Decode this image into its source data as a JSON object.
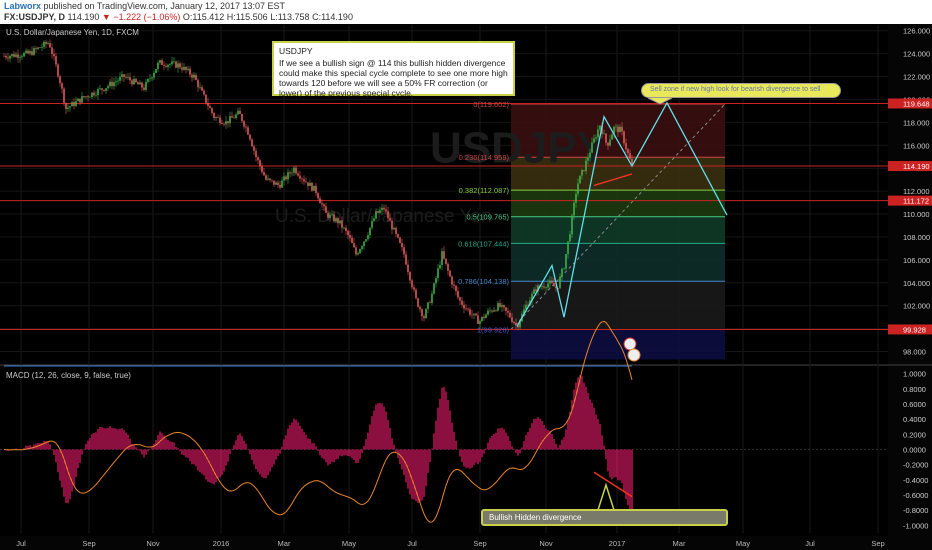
{
  "header": {
    "author": "Labworx",
    "published": " published on TradingView.com, January 12, 2017 13:07 EST",
    "symbol": "FX:USDJPY, D",
    "last": "114.190",
    "change": "▼ −1.222 (−1.06%)",
    "o": "O:115.412",
    "h": "H:115.506",
    "l": "L:113.758",
    "c": "C:114.190"
  },
  "chart_data": [
    {
      "type": "candlestick",
      "title": "U.S. Dollar/Japanese Yen, 1D, FXCM",
      "watermark_symbol": "USDJPY",
      "watermark_name": "U.S. Dollar/Japanese Yen",
      "ylim": [
        97,
        126.5
      ],
      "y_ticks": [
        "126.000",
        "124.000",
        "122.000",
        "120.000",
        "118.000",
        "116.000",
        "114.000",
        "112.000",
        "110.000",
        "108.000",
        "106.000",
        "104.000",
        "102.000",
        "100.000",
        "98.000"
      ],
      "x_ticks": [
        "Jul",
        "Sep",
        "Nov",
        "2016",
        "Mar",
        "May",
        "Jul",
        "Sep",
        "Nov",
        "2017",
        "Mar",
        "May",
        "Jul",
        "Sep"
      ],
      "path_keypoints": [
        {
          "t": 0,
          "v": 123.8
        },
        {
          "t": 25,
          "v": 124.0
        },
        {
          "t": 45,
          "v": 125.0
        },
        {
          "t": 55,
          "v": 122.0
        },
        {
          "t": 62,
          "v": 119.2
        },
        {
          "t": 80,
          "v": 120.2
        },
        {
          "t": 100,
          "v": 121.0
        },
        {
          "t": 120,
          "v": 122.0
        },
        {
          "t": 140,
          "v": 121.0
        },
        {
          "t": 155,
          "v": 123.2
        },
        {
          "t": 175,
          "v": 123.0
        },
        {
          "t": 190,
          "v": 122.0
        },
        {
          "t": 200,
          "v": 120.2
        },
        {
          "t": 210,
          "v": 118.5
        },
        {
          "t": 222,
          "v": 118.0
        },
        {
          "t": 235,
          "v": 118.8
        },
        {
          "t": 245,
          "v": 117.0
        },
        {
          "t": 252,
          "v": 115.0
        },
        {
          "t": 262,
          "v": 113.0
        },
        {
          "t": 275,
          "v": 112.5
        },
        {
          "t": 290,
          "v": 114.0
        },
        {
          "t": 300,
          "v": 113.0
        },
        {
          "t": 312,
          "v": 112.0
        },
        {
          "t": 322,
          "v": 110.0
        },
        {
          "t": 335,
          "v": 109.3
        },
        {
          "t": 345,
          "v": 108.0
        },
        {
          "t": 352,
          "v": 106.5
        },
        {
          "t": 362,
          "v": 108.0
        },
        {
          "t": 372,
          "v": 110.0
        },
        {
          "t": 380,
          "v": 110.5
        },
        {
          "t": 390,
          "v": 108.5
        },
        {
          "t": 400,
          "v": 106.5
        },
        {
          "t": 412,
          "v": 102.5
        },
        {
          "t": 420,
          "v": 101.0
        },
        {
          "t": 428,
          "v": 103.0
        },
        {
          "t": 438,
          "v": 106.5
        },
        {
          "t": 446,
          "v": 104.5
        },
        {
          "t": 455,
          "v": 102.5
        },
        {
          "t": 465,
          "v": 101.5
        },
        {
          "t": 475,
          "v": 100.6
        },
        {
          "t": 485,
          "v": 101.5
        },
        {
          "t": 495,
          "v": 102.0
        },
        {
          "t": 505,
          "v": 101.2
        },
        {
          "t": 513,
          "v": 100.2
        },
        {
          "t": 522,
          "v": 102.0
        },
        {
          "t": 532,
          "v": 103.5
        },
        {
          "t": 545,
          "v": 104.0
        },
        {
          "t": 553,
          "v": 103.5
        },
        {
          "t": 560,
          "v": 105.5
        },
        {
          "t": 567,
          "v": 109.0
        },
        {
          "t": 573,
          "v": 112.5
        },
        {
          "t": 580,
          "v": 114.0
        },
        {
          "t": 588,
          "v": 116.0
        },
        {
          "t": 596,
          "v": 117.8
        },
        {
          "t": 603,
          "v": 116.0
        },
        {
          "t": 610,
          "v": 117.5
        },
        {
          "t": 617,
          "v": 117.3
        },
        {
          "t": 623,
          "v": 115.5
        },
        {
          "t": 628,
          "v": 114.19
        }
      ],
      "horizontal_lines": [
        {
          "value": 119.648,
          "label": "119.648",
          "color": "#cc2222"
        },
        {
          "value": 114.19,
          "label": "114.190",
          "color": "#cc2222"
        },
        {
          "value": 111.172,
          "label": "111.172",
          "color": "#cc2222"
        },
        {
          "value": 99.928,
          "label": "99.928",
          "color": "#cc2222"
        }
      ],
      "fibonacci_levels": [
        {
          "label": "0(119.602)",
          "value": 119.602,
          "color": "#cc4444",
          "fill": "#3a1010"
        },
        {
          "label": "0.236(114.959)",
          "value": 114.959,
          "color": "#cc4444",
          "fill": "#3a3010"
        },
        {
          "label": "0.382(112.087)",
          "value": 112.087,
          "color": "#88cc44",
          "fill": "#1d3a10"
        },
        {
          "label": "0.5(109.765)",
          "value": 109.765,
          "color": "#44cc88",
          "fill": "#103a28"
        },
        {
          "label": "0.618(107.444)",
          "value": 107.444,
          "color": "#22aa88",
          "fill": "#0e2e2a"
        },
        {
          "label": "0.786(104.138)",
          "value": 104.138,
          "color": "#4488cc",
          "fill": "#1a1a1a"
        },
        {
          "label": "1(99.928)",
          "value": 99.928,
          "color": "#5555cc",
          "fill": "#0d0d40"
        }
      ],
      "projection_path": [
        {
          "t": 513,
          "v": 100.2
        },
        {
          "t": 548,
          "v": 105.5
        },
        {
          "t": 560,
          "v": 101.0
        },
        {
          "t": 600,
          "v": 118.5
        },
        {
          "t": 628,
          "v": 114.19
        },
        {
          "t": 663,
          "v": 119.7
        },
        {
          "t": 723,
          "v": 109.9
        }
      ],
      "annotations": [
        "USDJPY",
        "If we see a bullish sign @ 114 this bullish hidden divergence could make this special cycle complete to see one more high towards 120 before we will see a 50% FR correction (or lower) of the previous special cycle.",
        "Sell zone if new high look for bearish divergence to sell"
      ]
    },
    {
      "type": "macd",
      "title": "MACD (12, 26, close, 9, false, true)",
      "ylim": [
        -1.1,
        1.1
      ],
      "y_ticks": [
        "1.0000",
        "0.8000",
        "0.6000",
        "0.4000",
        "0.2000",
        "0.0000",
        "-0.2000",
        "-0.4000",
        "-0.6000",
        "-0.8000",
        "-1.0000"
      ],
      "annotation": "Bullish Hidden divergence"
    }
  ]
}
